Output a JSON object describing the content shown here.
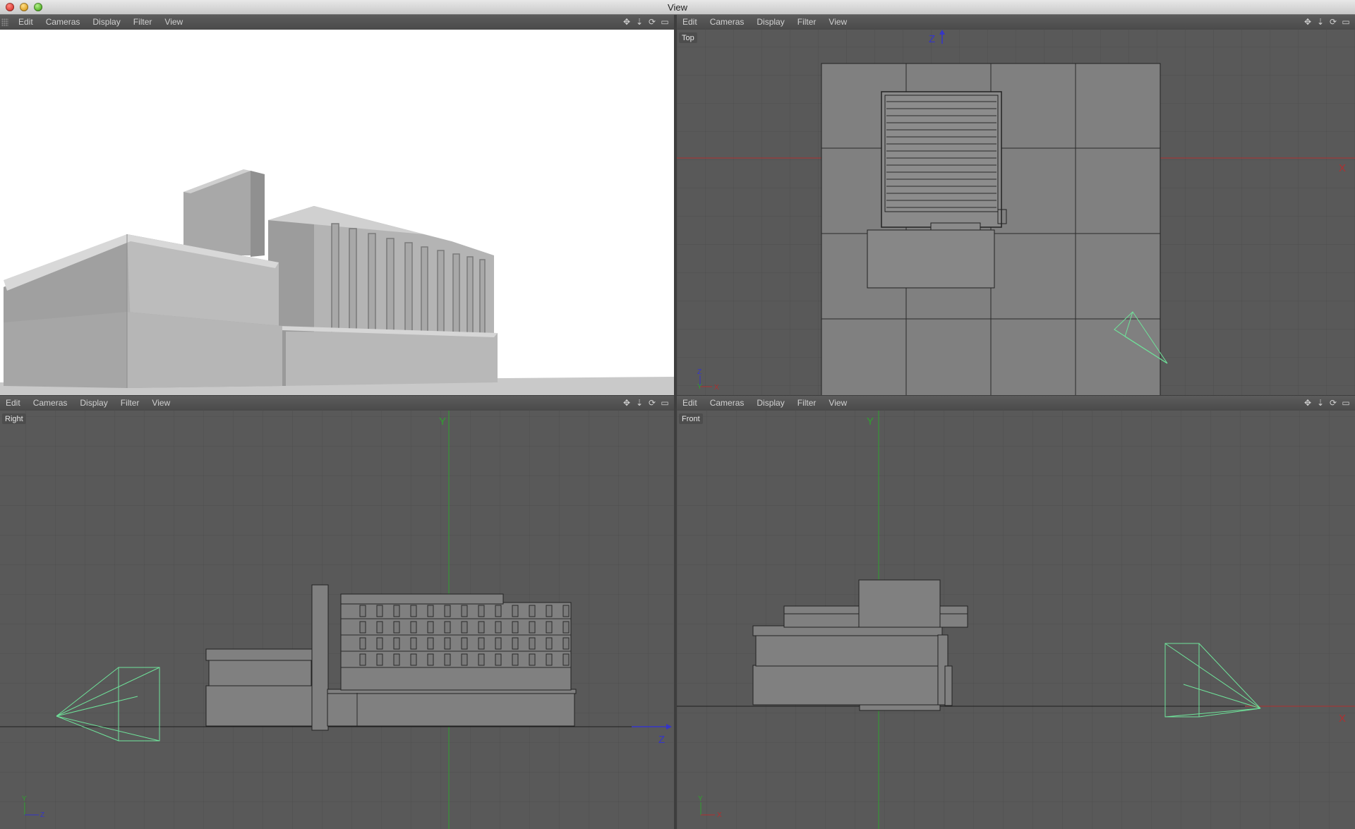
{
  "window": {
    "title": "View"
  },
  "menus": [
    "Edit",
    "Cameras",
    "Display",
    "Filter",
    "View"
  ],
  "viewports": {
    "perspective": {
      "label": ""
    },
    "top": {
      "label": "Top",
      "axes": {
        "vertical": "Z",
        "horizontal": "X"
      },
      "gizmo": {
        "up": "Z",
        "center": "Y",
        "right": "X"
      }
    },
    "right": {
      "label": "Right",
      "axes": {
        "vertical": "Y",
        "horizontal": "Z"
      },
      "gizmo": {
        "up": "Y",
        "right": "Z"
      }
    },
    "front": {
      "label": "Front",
      "axes": {
        "vertical": "Y",
        "horizontal": "X"
      },
      "gizmo": {
        "up": "Y",
        "right": "X"
      }
    }
  },
  "icons": [
    "move-view-icon",
    "zoom-view-icon",
    "rotate-view-icon",
    "maximize-view-icon"
  ],
  "colors": {
    "grid": "#4e4e4e",
    "viewport_bg": "#595959",
    "object": "#808080",
    "camera": "#6fe39a",
    "axis_x": "#b03030",
    "axis_y": "#2fa02f",
    "axis_z": "#3535c8"
  }
}
